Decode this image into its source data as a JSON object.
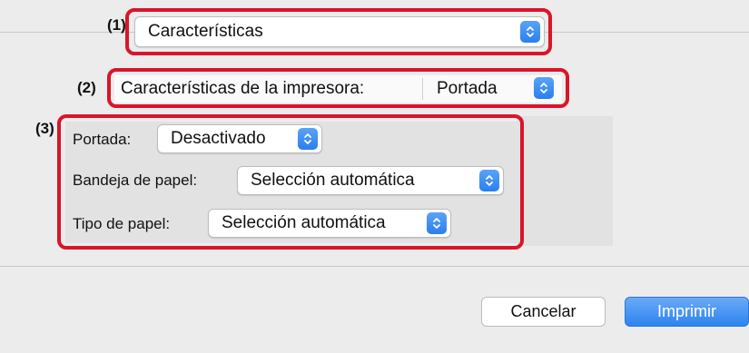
{
  "callouts": {
    "c1": "(1)",
    "c2": "(2)",
    "c3": "(3)"
  },
  "section_popup": {
    "value": "Características"
  },
  "printer_features": {
    "label": "Características de la impresora:",
    "value": "Portada"
  },
  "options": {
    "cover": {
      "label": "Portada:",
      "value": "Desactivado"
    },
    "paper_tray": {
      "label": "Bandeja de papel:",
      "value": "Selección automática"
    },
    "paper_type": {
      "label": "Tipo de papel:",
      "value": "Selección automática"
    }
  },
  "buttons": {
    "cancel": "Cancelar",
    "print": "Imprimir"
  },
  "colors": {
    "highlight": "#d9152b",
    "accent": "#2d84ef"
  }
}
